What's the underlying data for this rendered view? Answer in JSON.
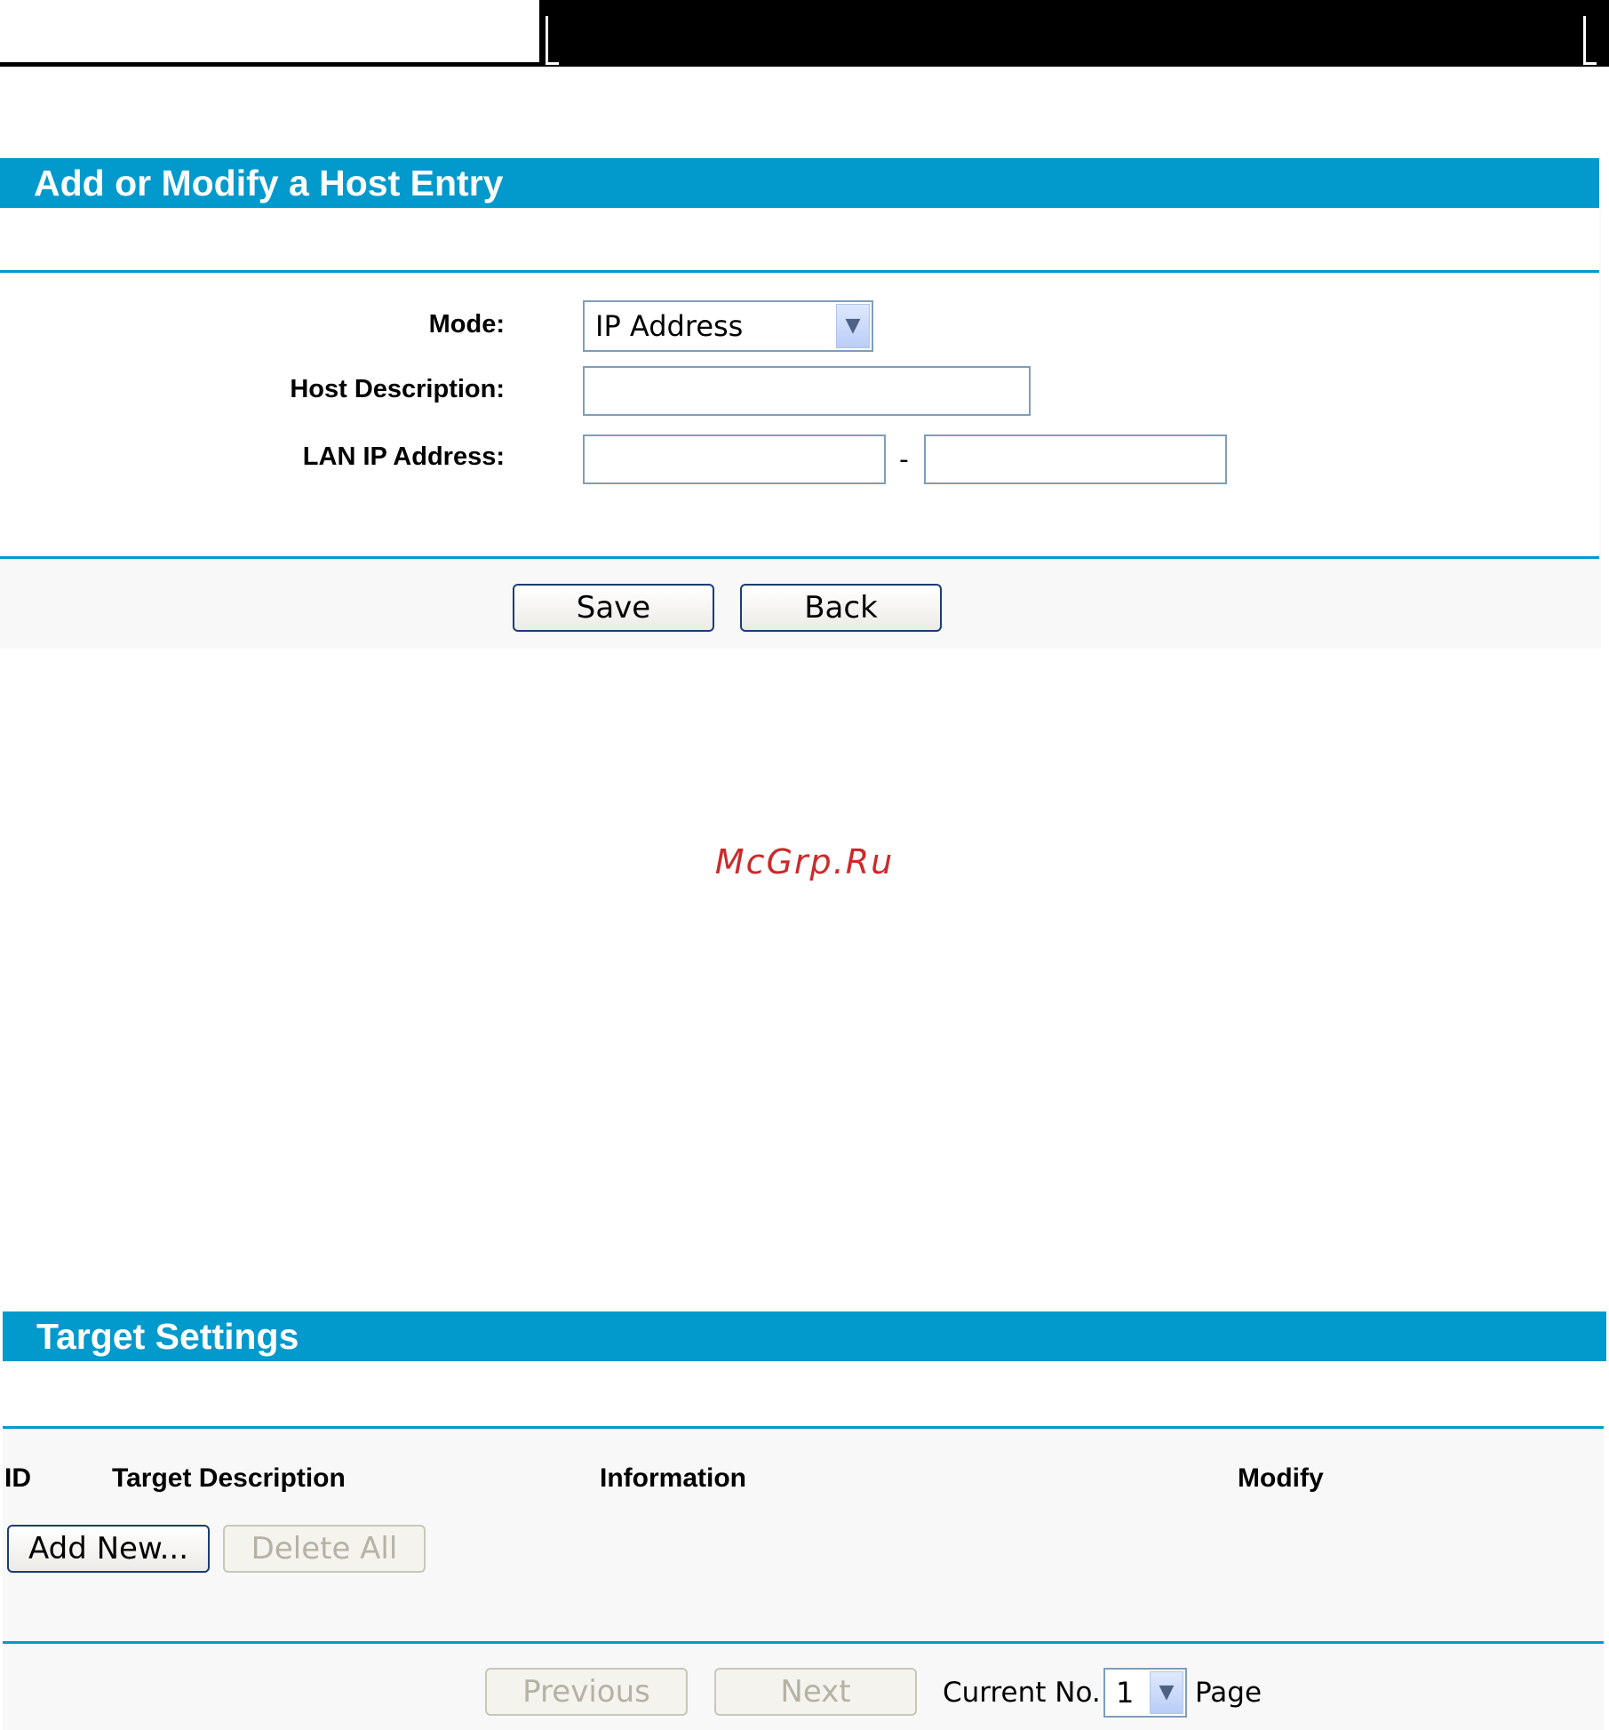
{
  "host_entry": {
    "title": "Add or Modify a Host Entry",
    "mode_label": "Mode:",
    "mode_value": "IP Address",
    "host_description_label": "Host Description:",
    "host_description_value": "",
    "lan_ip_label": "LAN IP Address:",
    "lan_ip_start_value": "",
    "lan_ip_end_value": "",
    "range_separator": "-",
    "save_label": "Save",
    "back_label": "Back"
  },
  "watermark": "McGrp.Ru",
  "target_settings": {
    "title": "Target Settings",
    "columns": [
      "ID",
      "Target Description",
      "Information",
      "Modify"
    ],
    "add_new_label": "Add New...",
    "delete_all_label": "Delete All",
    "previous_label": "Previous",
    "next_label": "Next",
    "current_no_label": "Current No.",
    "current_page_value": "1",
    "page_label": "Page"
  }
}
